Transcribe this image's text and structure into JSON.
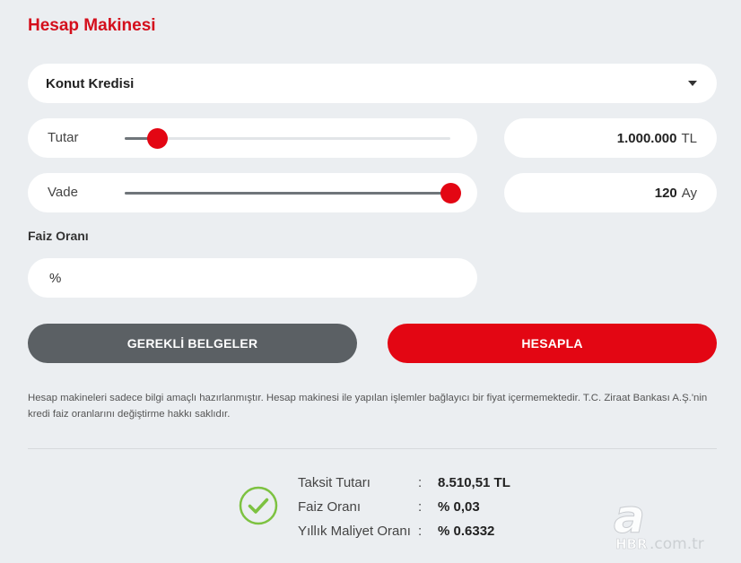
{
  "header": {
    "title": "Hesap Makinesi"
  },
  "loan_type": {
    "selected": "Konut Kredisi"
  },
  "amount": {
    "label": "Tutar",
    "value": "1.000.000",
    "unit": "TL",
    "slider_fraction": 0.1
  },
  "term": {
    "label": "Vade",
    "value": "120",
    "unit": "Ay",
    "slider_fraction": 1.0
  },
  "rate": {
    "label": "Faiz Oranı",
    "placeholder": "%"
  },
  "buttons": {
    "documents": "GEREKLİ BELGELER",
    "calculate": "HESAPLA"
  },
  "disclaimer": "Hesap makineleri sadece bilgi amaçlı hazırlanmıştır. Hesap makinesi ile yapılan işlemler bağlayıcı bir fiyat içermemektedir. T.C. Ziraat Bankası A.Ş.'nin kredi faiz oranlarını değiştirme hakkı saklıdır.",
  "results": [
    {
      "label": "Taksit Tutarı",
      "value": "8.510,51 TL"
    },
    {
      "label": "Faiz Oranı",
      "value": "% 0,03"
    },
    {
      "label": "Yıllık Maliyet Oranı",
      "value": "% 0.6332"
    }
  ],
  "separator": ":",
  "watermark": {
    "letter": "a",
    "brand": "HBR",
    "domain": ".com.tr"
  },
  "colors": {
    "accent": "#e30613",
    "title": "#d40f1c",
    "check": "#7dc241",
    "dark_button": "#5b6064"
  }
}
